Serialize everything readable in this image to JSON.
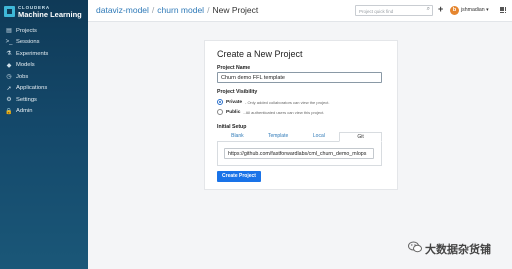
{
  "brand": {
    "top": "CLOUDERA",
    "bottom": "Machine Learning",
    "accent": "#3fb8d8"
  },
  "sidebar": {
    "items": [
      {
        "label": "Projects",
        "icon": "folder-icon"
      },
      {
        "label": "Sessions",
        "icon": "terminal-icon"
      },
      {
        "label": "Experiments",
        "icon": "flask-icon"
      },
      {
        "label": "Models",
        "icon": "cube-icon"
      },
      {
        "label": "Jobs",
        "icon": "clock-icon"
      },
      {
        "label": "Applications",
        "icon": "rocket-icon"
      },
      {
        "label": "Settings",
        "icon": "gear-icon"
      },
      {
        "label": "Admin",
        "icon": "lock-icon"
      }
    ]
  },
  "breadcrumb": {
    "item1": "dataviz-model",
    "item2": "churn model",
    "current": "New Project",
    "sep": "/"
  },
  "header": {
    "search_placeholder": "Project quick find",
    "plus": "+",
    "avatar_initial": "b",
    "username": "jshmadian ▾"
  },
  "form": {
    "title": "Create a New Project",
    "name_label": "Project Name",
    "name_value": "Churn demo FFL template",
    "visibility_label": "Project Visibility",
    "private_label": "Private",
    "private_desc": "- Only added collaborators can view the project.",
    "public_label": "Public",
    "public_desc": "- All authenticated users can view this project.",
    "setup_label": "Initial Setup",
    "tabs": [
      "Blank",
      "Template",
      "Local",
      "Git"
    ],
    "git_url": "https://github.com/fastforwardlabs/cml_churn_demo_mlops",
    "create_label": "Create Project"
  },
  "watermark": {
    "text": "大数据杂货铺"
  },
  "colors": {
    "sidebar": "#14486a",
    "primary": "#1a73e8",
    "link": "#2f7ab8"
  }
}
